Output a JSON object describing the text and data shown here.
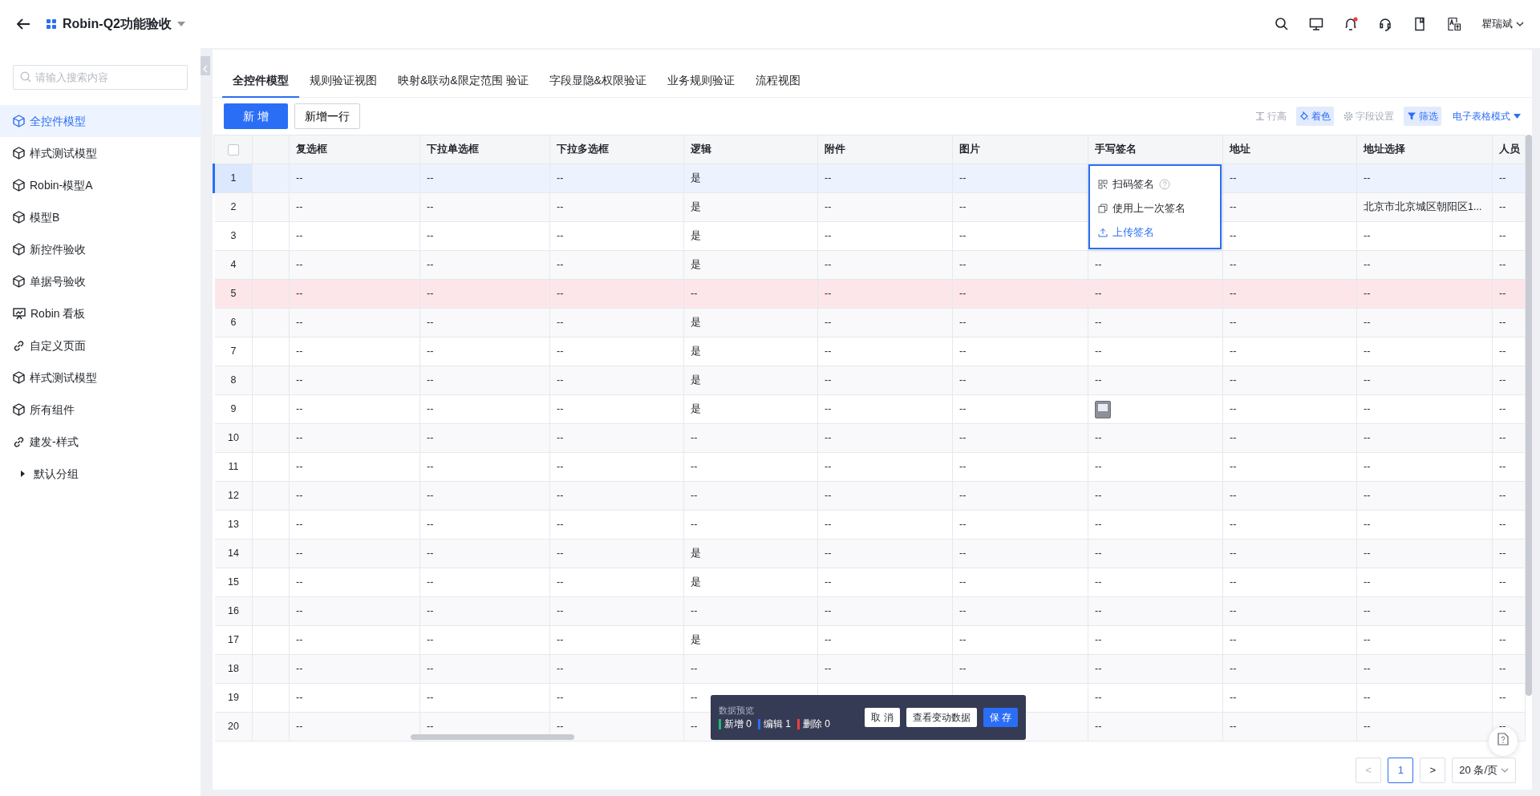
{
  "header": {
    "title": "Robin-Q2功能验收",
    "user": "瞿瑞斌",
    "notification_dot": true
  },
  "sidebar": {
    "search": {
      "placeholder": "请输入搜索内容"
    },
    "items": [
      {
        "label": "全控件模型",
        "kind": "model",
        "selected": true
      },
      {
        "label": "样式测试模型",
        "kind": "model",
        "selected": false
      },
      {
        "label": "Robin-模型A",
        "kind": "model",
        "selected": false
      },
      {
        "label": "模型B",
        "kind": "model",
        "selected": false
      },
      {
        "label": "新控件验收",
        "kind": "model",
        "selected": false
      },
      {
        "label": "单据号验收",
        "kind": "model",
        "selected": false
      },
      {
        "label": "Robin 看板",
        "kind": "dashboard",
        "selected": false
      },
      {
        "label": "自定义页面",
        "kind": "link",
        "selected": false
      },
      {
        "label": "样式测试模型",
        "kind": "model",
        "selected": false
      },
      {
        "label": "所有组件",
        "kind": "model",
        "selected": false
      },
      {
        "label": "建发-样式",
        "kind": "link",
        "selected": false
      },
      {
        "label": "默认分组",
        "kind": "group",
        "selected": false,
        "expanded": false
      }
    ]
  },
  "tabs": [
    {
      "label": "全控件模型",
      "selected": true
    },
    {
      "label": "规则验证视图",
      "selected": false
    },
    {
      "label": "映射&联动&限定范围 验证",
      "selected": false
    },
    {
      "label": "字段显隐&权限验证",
      "selected": false
    },
    {
      "label": "业务规则验证",
      "selected": false
    },
    {
      "label": "流程视图",
      "selected": false
    }
  ],
  "toolbar": {
    "add_button": "新 增",
    "add_row_button": "新增一行",
    "tools": [
      {
        "label": "行高",
        "kind": "row-height",
        "active": false
      },
      {
        "label": "着色",
        "kind": "color",
        "active": true
      },
      {
        "label": "字段设置",
        "kind": "settings",
        "active": false
      },
      {
        "label": "筛选",
        "kind": "filter",
        "active": true
      }
    ],
    "mode_dropdown": "电子表格模式"
  },
  "table": {
    "columns": [
      "复选框",
      "下拉单选框",
      "下拉多选框",
      "逻辑",
      "附件",
      "图片",
      "手写签名",
      "地址",
      "地址选择",
      "人员"
    ],
    "select_all": {
      "checked": false
    },
    "rows": [
      {
        "number": "1",
        "selected": true,
        "flagged": false,
        "cells": [
          "--",
          "--",
          "--",
          "是",
          "--",
          "--",
          null,
          "--",
          "--",
          "--"
        ]
      },
      {
        "number": "2",
        "selected": false,
        "flagged": false,
        "cells": [
          "--",
          "--",
          "--",
          "是",
          "--",
          "--",
          null,
          "--",
          "北京市北京城区朝阳区1...",
          "--"
        ]
      },
      {
        "number": "3",
        "selected": false,
        "flagged": false,
        "cells": [
          "--",
          "--",
          "--",
          "是",
          "--",
          "--",
          null,
          "--",
          "--",
          "--"
        ]
      },
      {
        "number": "4",
        "selected": false,
        "flagged": false,
        "cells": [
          "--",
          "--",
          "--",
          "是",
          "--",
          "--",
          "--",
          "--",
          "--",
          "--"
        ]
      },
      {
        "number": "5",
        "selected": false,
        "flagged": true,
        "cells": [
          "--",
          "--",
          "--",
          "--",
          "--",
          "--",
          "--",
          "--",
          "--",
          "--"
        ]
      },
      {
        "number": "6",
        "selected": false,
        "flagged": false,
        "cells": [
          "--",
          "--",
          "--",
          "是",
          "--",
          "--",
          "--",
          "--",
          "--",
          "--"
        ]
      },
      {
        "number": "7",
        "selected": false,
        "flagged": false,
        "cells": [
          "--",
          "--",
          "--",
          "是",
          "--",
          "--",
          "--",
          "--",
          "--",
          "--"
        ]
      },
      {
        "number": "8",
        "selected": false,
        "flagged": false,
        "cells": [
          "--",
          "--",
          "--",
          "是",
          "--",
          "--",
          "--",
          "--",
          "--",
          "--"
        ]
      },
      {
        "number": "9",
        "selected": false,
        "flagged": false,
        "cells": [
          "--",
          "--",
          "--",
          "是",
          "--",
          "--",
          {
            "kind": "signature-image"
          },
          "--",
          "--",
          "--"
        ]
      },
      {
        "number": "10",
        "selected": false,
        "flagged": false,
        "cells": [
          "--",
          "--",
          "--",
          "--",
          "--",
          "--",
          "--",
          "--",
          "--",
          "--"
        ]
      },
      {
        "number": "11",
        "selected": false,
        "flagged": false,
        "cells": [
          "--",
          "--",
          "--",
          "--",
          "--",
          "--",
          "--",
          "--",
          "--",
          "--"
        ]
      },
      {
        "number": "12",
        "selected": false,
        "flagged": false,
        "cells": [
          "--",
          "--",
          "--",
          "--",
          "--",
          "--",
          "--",
          "--",
          "--",
          "--"
        ]
      },
      {
        "number": "13",
        "selected": false,
        "flagged": false,
        "cells": [
          "--",
          "--",
          "--",
          "--",
          "--",
          "--",
          "--",
          "--",
          "--",
          "--"
        ]
      },
      {
        "number": "14",
        "selected": false,
        "flagged": false,
        "cells": [
          "--",
          "--",
          "--",
          "是",
          "--",
          "--",
          "--",
          "--",
          "--",
          "--"
        ]
      },
      {
        "number": "15",
        "selected": false,
        "flagged": false,
        "cells": [
          "--",
          "--",
          "--",
          "是",
          "--",
          "--",
          "--",
          "--",
          "--",
          "--"
        ]
      },
      {
        "number": "16",
        "selected": false,
        "flagged": false,
        "cells": [
          "--",
          "--",
          "--",
          "--",
          "--",
          "--",
          "--",
          "--",
          "--",
          "--"
        ]
      },
      {
        "number": "17",
        "selected": false,
        "flagged": false,
        "cells": [
          "--",
          "--",
          "--",
          "是",
          "--",
          "--",
          "--",
          "--",
          "--",
          "--"
        ]
      },
      {
        "number": "18",
        "selected": false,
        "flagged": false,
        "cells": [
          "--",
          "--",
          "--",
          "--",
          "--",
          "--",
          "--",
          "--",
          "--",
          "--"
        ]
      },
      {
        "number": "19",
        "selected": false,
        "flagged": false,
        "cells": [
          "--",
          "--",
          "--",
          "--",
          null,
          null,
          "--",
          "--",
          "--",
          "--"
        ]
      },
      {
        "number": "20",
        "selected": false,
        "flagged": false,
        "cells": [
          "--",
          "--",
          "--",
          "--",
          null,
          null,
          "--",
          "--",
          "--",
          "--"
        ]
      }
    ]
  },
  "signature_menu": [
    {
      "label": "扫码签名",
      "kind": "scan",
      "selected": false
    },
    {
      "label": "使用上一次签名",
      "kind": "previous",
      "selected": false
    },
    {
      "label": "上传签名",
      "kind": "upload",
      "selected": true
    }
  ],
  "data_preview": {
    "title": "数据预览",
    "counts": [
      {
        "label": "新增 0",
        "color": "#19be6b"
      },
      {
        "label": "编辑 1",
        "color": "#2b6ef6"
      },
      {
        "label": "删除 0",
        "color": "#f03e3e"
      }
    ],
    "buttons": [
      {
        "label": "取 消",
        "kind": "plain"
      },
      {
        "label": "查看变动数据",
        "kind": "plain"
      },
      {
        "label": "保 存",
        "kind": "primary"
      }
    ]
  },
  "pagination": {
    "prev": {
      "label": "<",
      "disabled": true
    },
    "pages": [
      {
        "label": "1",
        "selected": true
      }
    ],
    "next": {
      "label": ">",
      "disabled": false
    },
    "page_size": "20 条/页"
  }
}
